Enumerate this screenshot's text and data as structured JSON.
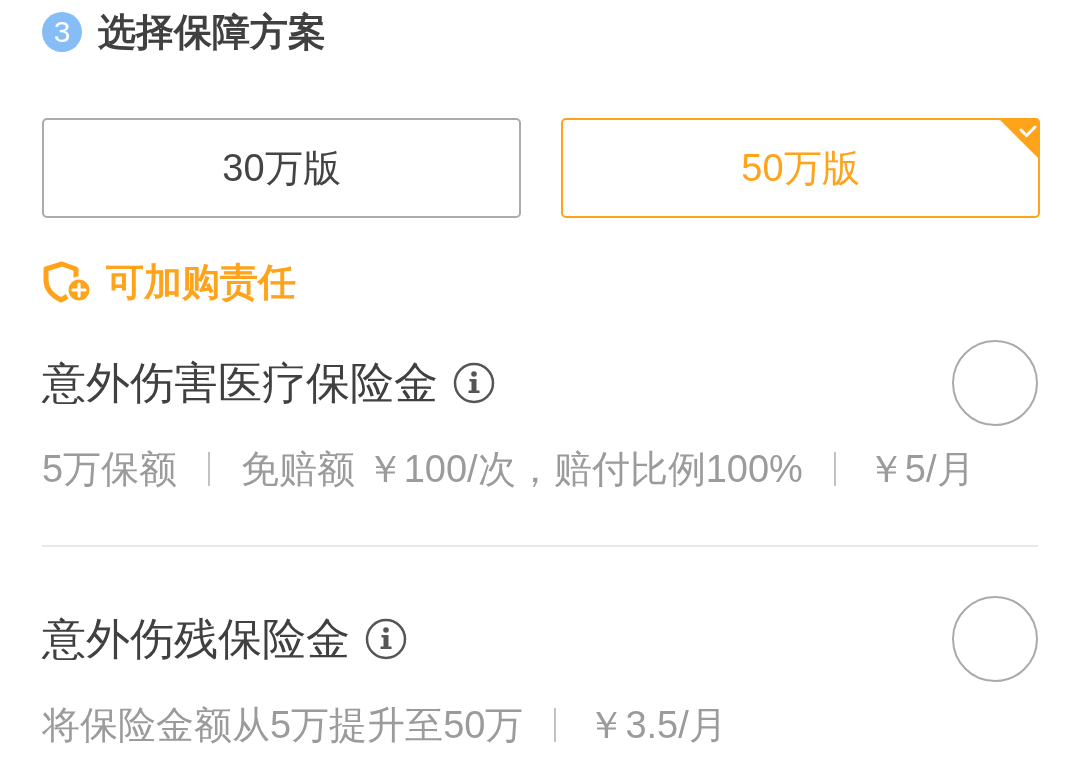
{
  "step": {
    "number": "3",
    "title": "选择保障方案"
  },
  "plans": [
    {
      "label": "30万版",
      "selected": false
    },
    {
      "label": "50万版",
      "selected": true
    }
  ],
  "addons": {
    "title": "可加购责任",
    "items": [
      {
        "name": "意外伤害医疗保险金",
        "checked": false,
        "details": [
          "5万保额",
          "免赔额 ￥100/次，赔付比例100%",
          "￥5/月"
        ]
      },
      {
        "name": "意外伤残保险金",
        "checked": false,
        "details": [
          "将保险金额从5万提升至50万",
          "￥3.5/月"
        ]
      }
    ]
  }
}
